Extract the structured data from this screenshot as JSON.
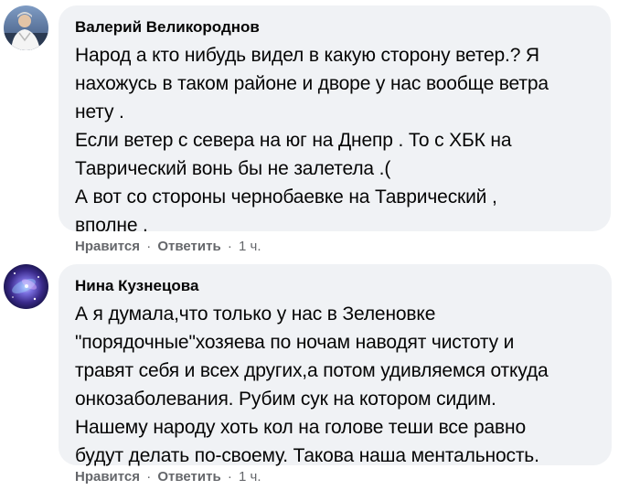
{
  "comments": [
    {
      "author": "Валерий Великороднов",
      "lines": [
        "Народ а кто нибудь видел в какую сторону ветер.? Я",
        "нахожусь в таком районе и дворе у нас вообще ветра",
        "нету .",
        "Если ветер с севера на юг на Днепр . То с ХБК на",
        "Таврический вонь бы не залетела .(",
        "А вот со стороны чернобаевке на Таврический ,",
        "вполне ."
      ],
      "like_label": "Нравится",
      "reply_label": "Ответить",
      "separator": "·",
      "time": "1 ч."
    },
    {
      "author": "Нина Кузнецова",
      "lines": [
        "А я думала,что только у нас в Зеленовке",
        "\"порядочные\"хозяева по ночам наводят чистоту и",
        "травят себя и всех других,а потом удивляемся откуда",
        "онкозаболевания. Рубим сук на котором сидим.",
        "Нашему народу хоть кол на голове теши все равно",
        "будут делать по-своему. Такова наша ментальность."
      ],
      "like_label": "Нравится",
      "reply_label": "Ответить",
      "separator": "·",
      "time": "1 ч."
    }
  ],
  "colors": {
    "bubble": "#f0f2f5",
    "text": "#050505",
    "meta": "#65676b"
  },
  "icons": {
    "avatar_1": "profile-photo-man",
    "avatar_2": "profile-photo-galaxy"
  }
}
